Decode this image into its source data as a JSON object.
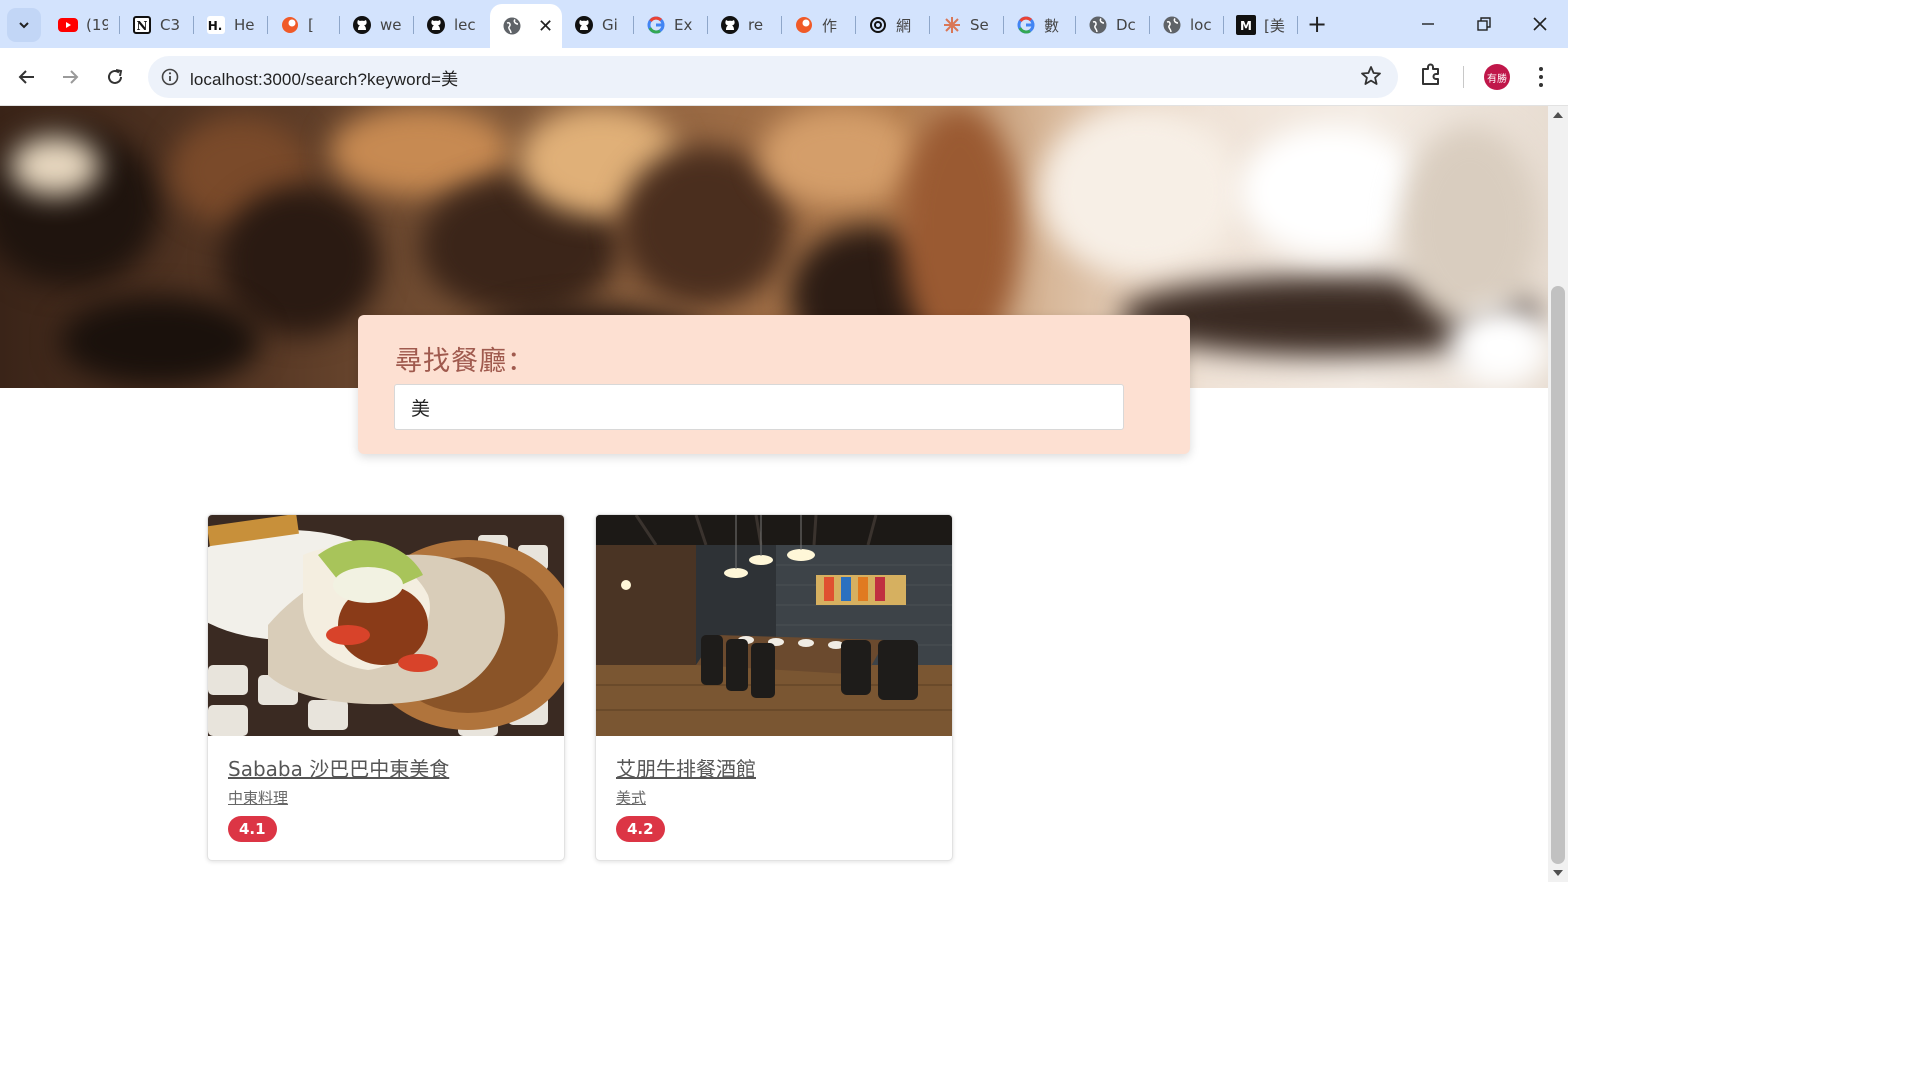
{
  "browser": {
    "tabs": [
      {
        "title": "(19",
        "icon": "youtube-icon",
        "color": "#ff0000"
      },
      {
        "title": "C3",
        "icon": "notion-icon",
        "color": "#111111"
      },
      {
        "title": "He",
        "icon": "hahow-icon",
        "color": "#111111"
      },
      {
        "title": "[",
        "icon": "orange-logo-icon",
        "color": "#f05a28"
      },
      {
        "title": "we",
        "icon": "github-icon",
        "color": "#111111"
      },
      {
        "title": "lec",
        "icon": "github-icon",
        "color": "#111111"
      },
      {
        "title": "",
        "icon": "globe-icon",
        "color": "#555555",
        "active": true
      },
      {
        "title": "Gi",
        "icon": "github-icon",
        "color": "#111111"
      },
      {
        "title": "Ex",
        "icon": "google-icon",
        "color": "#4285f4"
      },
      {
        "title": "re",
        "icon": "github-icon",
        "color": "#111111"
      },
      {
        "title": "作",
        "icon": "orange-logo-icon",
        "color": "#f05a28"
      },
      {
        "title": "網",
        "icon": "openai-icon",
        "color": "#111111"
      },
      {
        "title": "Se",
        "icon": "claude-icon",
        "color": "#d97757"
      },
      {
        "title": "數",
        "icon": "google-icon",
        "color": "#4285f4"
      },
      {
        "title": "Dc",
        "icon": "globe-icon",
        "color": "#555555"
      },
      {
        "title": "loc",
        "icon": "globe-icon",
        "color": "#555555"
      },
      {
        "title": "[美",
        "icon": "medium-icon",
        "color": "#111111"
      }
    ],
    "url": "localhost:3000/search?keyword=美",
    "profile_initials": "有勝"
  },
  "search": {
    "title": "尋找餐廳：",
    "value": "美"
  },
  "restaurants": [
    {
      "name": "Sababa 沙巴巴中東美食",
      "category": "中東料理",
      "rating": "4.1"
    },
    {
      "name": "艾朋牛排餐酒館",
      "category": "美式",
      "rating": "4.2"
    }
  ],
  "colors": {
    "panel_bg": "#fde0d2",
    "panel_title": "#a05a4e",
    "badge": "#dc3545",
    "tabstrip": "#d3e3fd"
  }
}
